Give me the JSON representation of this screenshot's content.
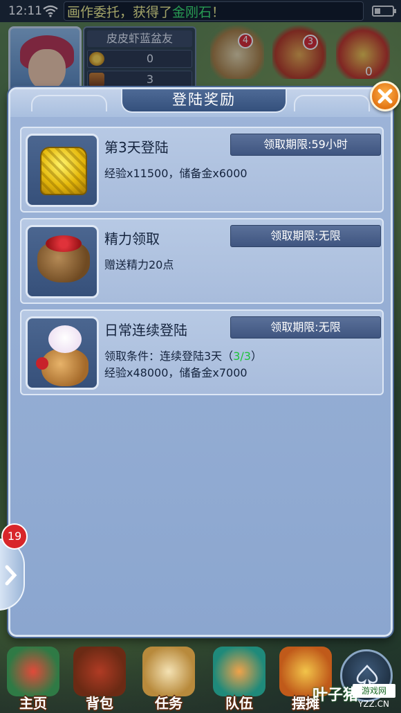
{
  "status_bar": {
    "time": "12:11",
    "notice_prefix": "画作委托，获得了",
    "notice_highlight": "金刚石",
    "notice_suffix": "！"
  },
  "player": {
    "name": "皮皮虾蓝盆友",
    "coins": "0",
    "chests": "3"
  },
  "top_icons": [
    {
      "icon": "scroll-quest-icon",
      "badge": "4"
    },
    {
      "icon": "treasure-chest-icon",
      "badge": "3"
    },
    {
      "icon": "golden-mask-icon",
      "count": "0"
    }
  ],
  "dialog": {
    "title": "登陆奖励",
    "close_icon": "close-icon"
  },
  "rewards": [
    {
      "title": "第3天登陆",
      "deadline": "领取期限:59小时",
      "line1": "经验x11500，储备金x6000",
      "icon": "golden-chest-icon"
    },
    {
      "title": "精力领取",
      "deadline": "领取期限:无限",
      "line1": "赠送精力20点",
      "icon": "wine-jar-icon"
    },
    {
      "title": "日常连续登陆",
      "deadline": "领取期限:无限",
      "line1_prefix": "领取条件：连续登陆3天（",
      "line1_progress": "3/3",
      "line1_suffix": "）",
      "line2": "经验x48000，储备金x7000",
      "icon": "lucky-cat-bag-icon"
    }
  ],
  "side_tab": {
    "badge": "19"
  },
  "bottom_nav": [
    {
      "label": "主页",
      "icon": "home-pavilion-icon"
    },
    {
      "label": "背包",
      "icon": "backpack-chest-icon"
    },
    {
      "label": "任务",
      "icon": "task-scroll-icon"
    },
    {
      "label": "队伍",
      "icon": "team-icon"
    },
    {
      "label": "摆摊",
      "icon": "stall-coin-icon"
    }
  ],
  "watermark": {
    "main": "叶子猪",
    "box": "游戏网",
    "url": "YZZ.CN"
  },
  "colors": {
    "dialog_bg": "#9db4d8",
    "title_plate": "#34507c",
    "deadline_btn": "#4a6290",
    "close_orange": "#e27514",
    "progress_green": "#1ec23a",
    "notice_yellow": "#f5f08a",
    "notice_green": "#39e36a",
    "badge_red": "#d8262a"
  }
}
